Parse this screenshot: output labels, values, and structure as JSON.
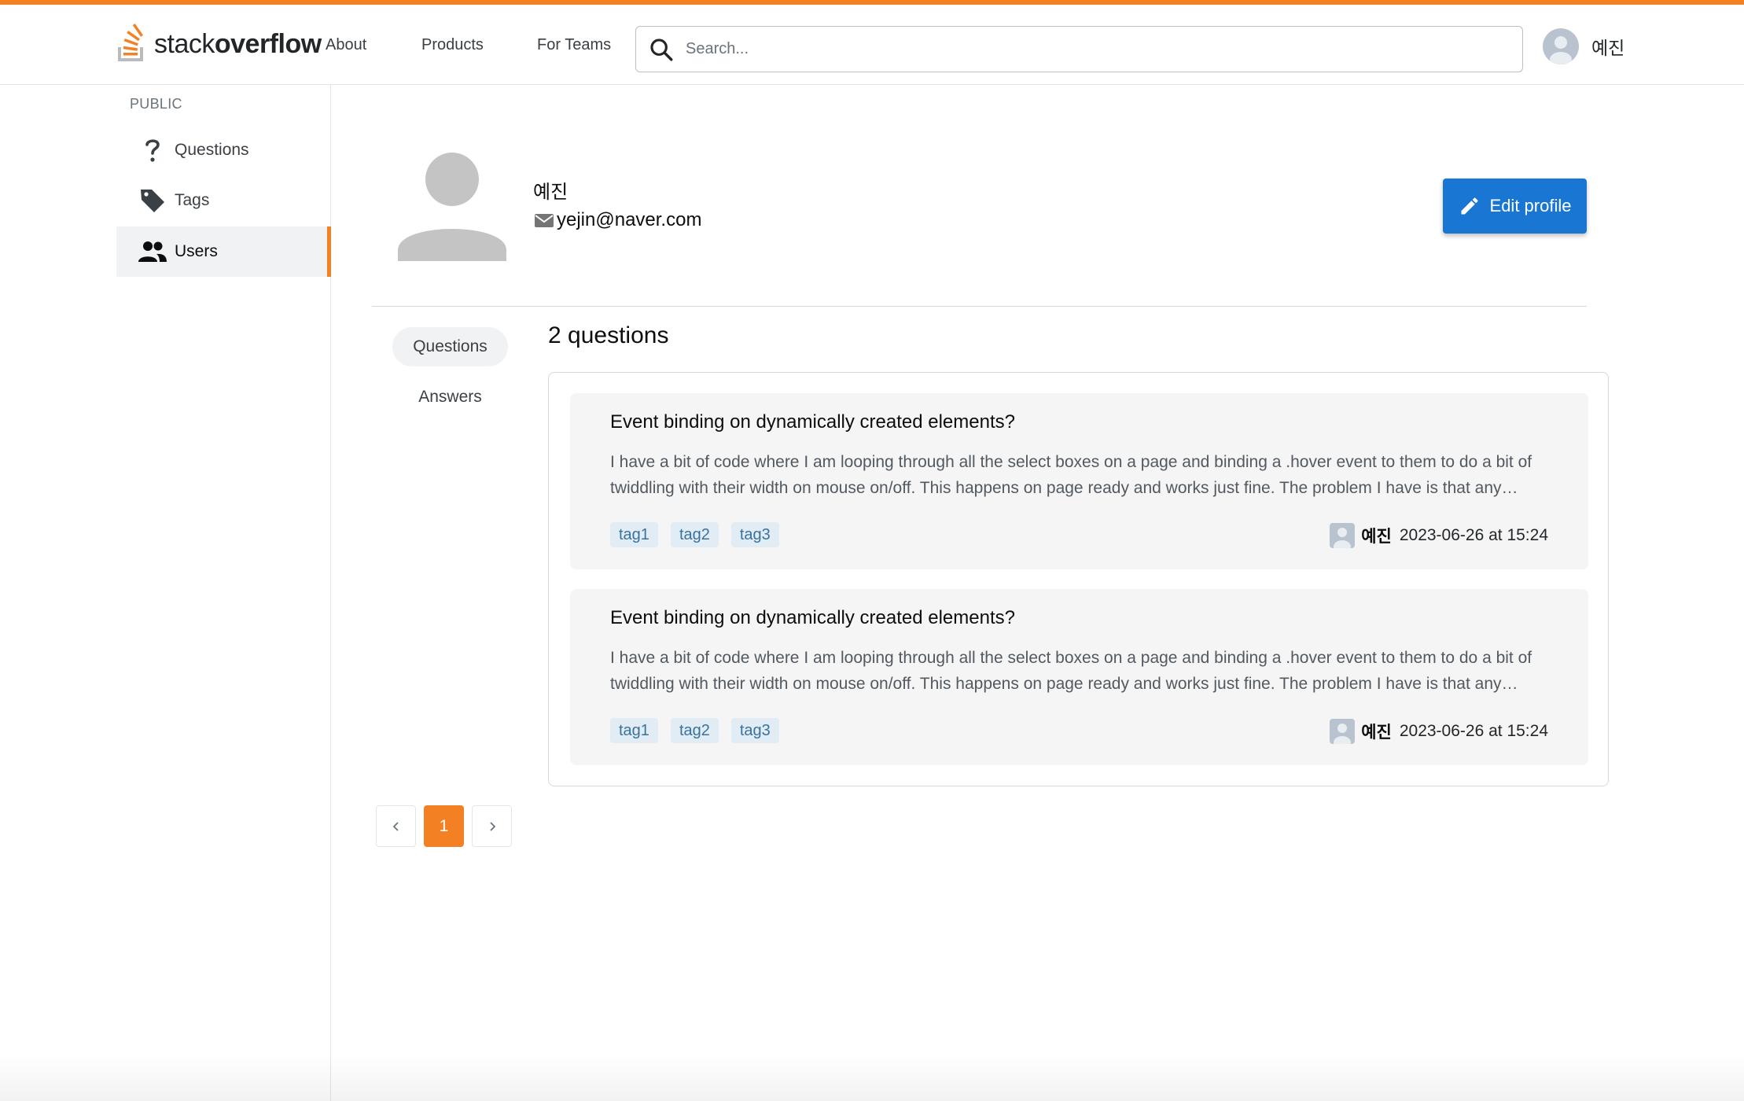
{
  "header": {
    "logo_prefix": "stack",
    "logo_suffix": "overflow",
    "nav": [
      "About",
      "Products",
      "For Teams"
    ],
    "search_placeholder": "Search...",
    "user_name": "예진"
  },
  "sidebar": {
    "section_label": "PUBLIC",
    "items": [
      {
        "label": "Questions",
        "icon": "question-mark-icon",
        "active": false
      },
      {
        "label": "Tags",
        "icon": "tag-icon",
        "active": false
      },
      {
        "label": "Users",
        "icon": "users-icon",
        "active": true
      }
    ]
  },
  "profile": {
    "name": "예진",
    "email": "yejin@naver.com",
    "edit_label": "Edit profile"
  },
  "tabs": [
    "Questions",
    "Answers"
  ],
  "questions_count_label": "2 questions",
  "questions": [
    {
      "title": "Event binding on dynamically created elements?",
      "excerpt": "I have a bit of code where I am looping through all the select boxes on a page and binding a .hover event to them to do a bit of twiddling with their width on mouse on/off. This happens on page ready and works just fine. The problem I have is that any…",
      "tags": [
        "tag1",
        "tag2",
        "tag3"
      ],
      "author": "예진",
      "date": "2023-06-26 at 15:24"
    },
    {
      "title": "Event binding on dynamically created elements?",
      "excerpt": "I have a bit of code where I am looping through all the select boxes on a page and binding a .hover event to them to do a bit of twiddling with their width on mouse on/off. This happens on page ready and works just fine. The problem I have is that any…",
      "tags": [
        "tag1",
        "tag2",
        "tag3"
      ],
      "author": "예진",
      "date": "2023-06-26 at 15:24"
    }
  ],
  "pagination": {
    "prev_icon": "chevron-left-icon",
    "current_page": "1",
    "next_icon": "chevron-right-icon"
  },
  "colors": {
    "accent": "#f48024",
    "primary_button": "#1976d2",
    "tag_bg": "#e1ecf4",
    "tag_text": "#39739d"
  }
}
